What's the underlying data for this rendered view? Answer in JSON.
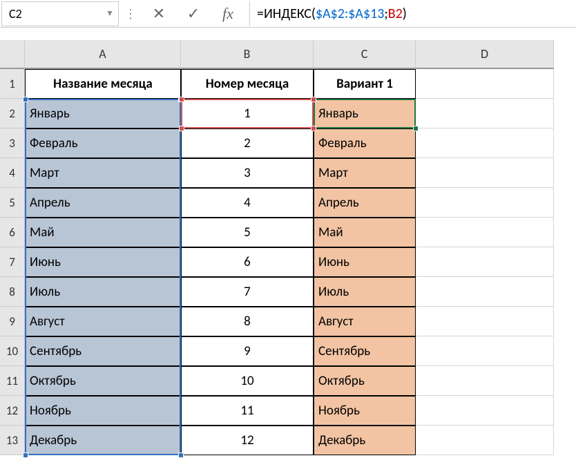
{
  "nameBox": "C2",
  "formula": {
    "prefix": "=ИНДЕКС(",
    "range": "$A$2:$A$13",
    "sep": ";",
    "arg2": "B2",
    "suffix": ")"
  },
  "columns": [
    "A",
    "B",
    "C",
    "D"
  ],
  "rows": [
    "1",
    "2",
    "3",
    "4",
    "5",
    "6",
    "7",
    "8",
    "9",
    "10",
    "11",
    "12",
    "13"
  ],
  "header": {
    "a": "Название месяца",
    "b": "Номер месяца",
    "c": "Вариант 1"
  },
  "data": [
    {
      "a": "Январь",
      "b": "1",
      "c": "Январь"
    },
    {
      "a": "Февраль",
      "b": "2",
      "c": "Февраль"
    },
    {
      "a": "Март",
      "b": "3",
      "c": "Март"
    },
    {
      "a": "Апрель",
      "b": "4",
      "c": "Апрель"
    },
    {
      "a": "Май",
      "b": "5",
      "c": "Май"
    },
    {
      "a": "Июнь",
      "b": "6",
      "c": "Июнь"
    },
    {
      "a": "Июль",
      "b": "7",
      "c": "Июль"
    },
    {
      "a": "Август",
      "b": "8",
      "c": "Август"
    },
    {
      "a": "Сентябрь",
      "b": "9",
      "c": "Сентябрь"
    },
    {
      "a": "Октябрь",
      "b": "10",
      "c": "Октябрь"
    },
    {
      "a": "Ноябрь",
      "b": "11",
      "c": "Ноябрь"
    },
    {
      "a": "Декабрь",
      "b": "12",
      "c": "Декабрь"
    }
  ]
}
